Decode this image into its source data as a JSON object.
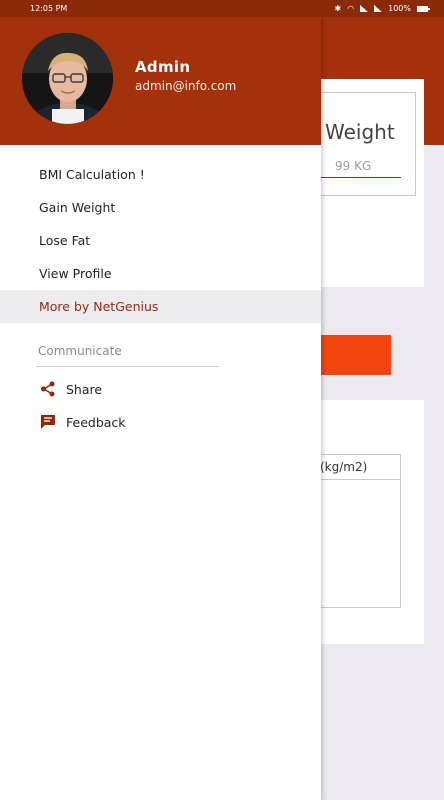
{
  "status_bar": {
    "time": "12:05 PM",
    "battery": "100%"
  },
  "background": {
    "weight_title": "Weight",
    "weight_value": "99 KG",
    "table_header": "(kg/m2)"
  },
  "drawer": {
    "user": {
      "name": "Admin",
      "email": "admin@info.com"
    },
    "menu_items": [
      {
        "label": "BMI Calculation !"
      },
      {
        "label": "Gain Weight"
      },
      {
        "label": "Lose Fat"
      },
      {
        "label": "View Profile"
      },
      {
        "label": "More by NetGenius"
      }
    ],
    "communicate": {
      "title": "Communicate",
      "share_label": "Share",
      "feedback_label": "Feedback"
    }
  },
  "colors": {
    "primary": "#a3310a",
    "status_bar": "#8a2a08",
    "accent_button": "#f1440e",
    "active_item_bg": "#ecebef"
  }
}
